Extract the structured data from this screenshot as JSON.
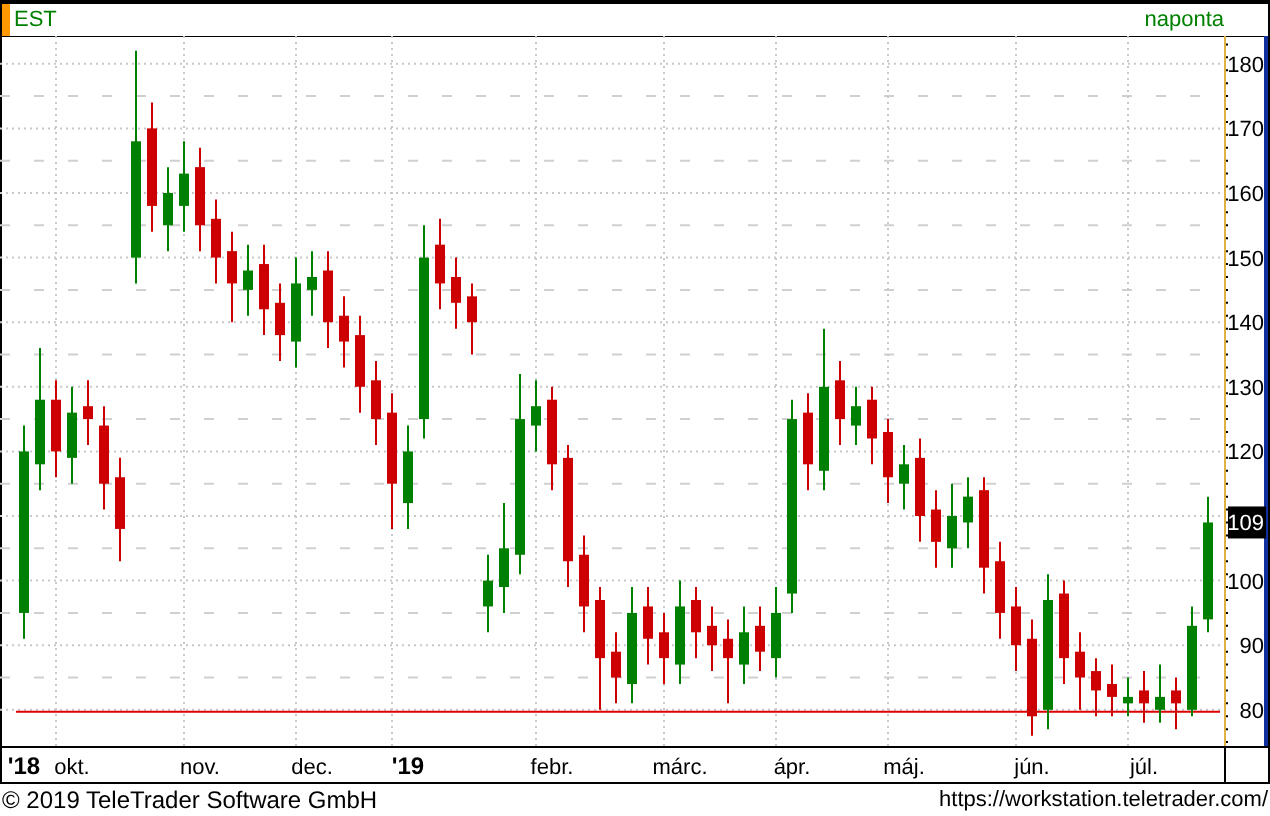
{
  "header": {
    "symbol": "EST",
    "interval": "naponta"
  },
  "chart": {
    "last_price_label": "109",
    "x_axis": [
      {
        "kind": "year"
      },
      {
        "kind": "month"
      },
      {
        "kind": "month"
      },
      {
        "kind": "month"
      },
      {
        "kind": "year"
      },
      {
        "kind": "month"
      },
      {
        "kind": "month"
      },
      {
        "kind": "month"
      },
      {
        "kind": "month"
      },
      {
        "kind": "month"
      },
      {
        "kind": "month"
      }
    ],
    "chart_data": {
      "type": "candlestick",
      "categories": [
        "'18",
        null,
        null,
        "okt.",
        null,
        null,
        null,
        null,
        null,
        null,
        null,
        "nov.",
        null,
        null,
        null,
        null,
        null,
        null,
        "dec.",
        null,
        null,
        null,
        null,
        null,
        "'19",
        null,
        null,
        null,
        null,
        null,
        null,
        null,
        null,
        "febr.",
        null,
        null,
        null,
        null,
        null,
        null,
        null,
        "márc.",
        null,
        null,
        null,
        null,
        null,
        null,
        "ápr.",
        null,
        null,
        null,
        null,
        null,
        null,
        "máj.",
        null,
        null,
        null,
        null,
        null,
        null,
        null,
        "jún.",
        null,
        null,
        null,
        null,
        null,
        null,
        "júl.",
        null,
        null,
        null,
        null
      ],
      "ohlc": [
        [
          95,
          124,
          91,
          120
        ],
        [
          118,
          136,
          114,
          128
        ],
        [
          128,
          131,
          116,
          120
        ],
        [
          119,
          130,
          115,
          126
        ],
        [
          127,
          131,
          121,
          125
        ],
        [
          124,
          127,
          111,
          115
        ],
        [
          116,
          119,
          103,
          108
        ],
        [
          150,
          182,
          146,
          168
        ],
        [
          170,
          174,
          154,
          158
        ],
        [
          155,
          164,
          151,
          160
        ],
        [
          158,
          168,
          154,
          163
        ],
        [
          164,
          167,
          151,
          155
        ],
        [
          156,
          159,
          146,
          150
        ],
        [
          151,
          154,
          140,
          146
        ],
        [
          145,
          152,
          141,
          148
        ],
        [
          149,
          152,
          138,
          142
        ],
        [
          143,
          146,
          134,
          138
        ],
        [
          137,
          150,
          133,
          146
        ],
        [
          145,
          151,
          141,
          147
        ],
        [
          148,
          151,
          136,
          140
        ],
        [
          141,
          144,
          133,
          137
        ],
        [
          138,
          141,
          126,
          130
        ],
        [
          131,
          134,
          121,
          125
        ],
        [
          126,
          129,
          108,
          115
        ],
        [
          112,
          124,
          108,
          120
        ],
        [
          125,
          155,
          122,
          150
        ],
        [
          152,
          156,
          142,
          146
        ],
        [
          147,
          150,
          139,
          143
        ],
        [
          144,
          146,
          135,
          140
        ],
        [
          96,
          104,
          92,
          100
        ],
        [
          99,
          112,
          95,
          105
        ],
        [
          104,
          132,
          101,
          125
        ],
        [
          124,
          131,
          120,
          127
        ],
        [
          128,
          130,
          114,
          118
        ],
        [
          119,
          121,
          99,
          103
        ],
        [
          104,
          107,
          92,
          96
        ],
        [
          97,
          99,
          80,
          88
        ],
        [
          89,
          92,
          81,
          85
        ],
        [
          84,
          99,
          81,
          95
        ],
        [
          96,
          99,
          87,
          91
        ],
        [
          92,
          95,
          84,
          88
        ],
        [
          87,
          100,
          84,
          96
        ],
        [
          97,
          99,
          88,
          92
        ],
        [
          93,
          96,
          86,
          90
        ],
        [
          91,
          94,
          81,
          88
        ],
        [
          87,
          96,
          84,
          92
        ],
        [
          93,
          96,
          86,
          89
        ],
        [
          88,
          99,
          85,
          95
        ],
        [
          98,
          128,
          95,
          125
        ],
        [
          126,
          129,
          114,
          118
        ],
        [
          117,
          139,
          114,
          130
        ],
        [
          131,
          134,
          121,
          125
        ],
        [
          124,
          130,
          121,
          127
        ],
        [
          128,
          130,
          118,
          122
        ],
        [
          123,
          125,
          112,
          116
        ],
        [
          115,
          121,
          111,
          118
        ],
        [
          119,
          122,
          106,
          110
        ],
        [
          111,
          114,
          102,
          106
        ],
        [
          105,
          115,
          102,
          110
        ],
        [
          109,
          116,
          105,
          113
        ],
        [
          114,
          116,
          98,
          102
        ],
        [
          103,
          106,
          91,
          95
        ],
        [
          96,
          99,
          86,
          90
        ],
        [
          91,
          94,
          76,
          79
        ],
        [
          80,
          101,
          77,
          97
        ],
        [
          98,
          100,
          84,
          88
        ],
        [
          89,
          92,
          80,
          85
        ],
        [
          86,
          88,
          79,
          83
        ],
        [
          84,
          87,
          79,
          82
        ],
        [
          81,
          85,
          79,
          82
        ],
        [
          83,
          86,
          78,
          81
        ],
        [
          80,
          87,
          78,
          82
        ],
        [
          83,
          85,
          77,
          81
        ],
        [
          80,
          96,
          79,
          93
        ],
        [
          94,
          113,
          92,
          109
        ]
      ],
      "ylim": [
        74.4,
        184.3
      ],
      "yticks": [
        80,
        90,
        100,
        120,
        130,
        140,
        150,
        160,
        170,
        180
      ],
      "grid": true,
      "ref_lines": [
        {
          "axis": "y",
          "value": 79.7
        }
      ]
    }
  },
  "footer": {
    "copyright": "© 2019 TeleTrader Software GmbH",
    "url": "https://workstation.teletrader.com/"
  }
}
